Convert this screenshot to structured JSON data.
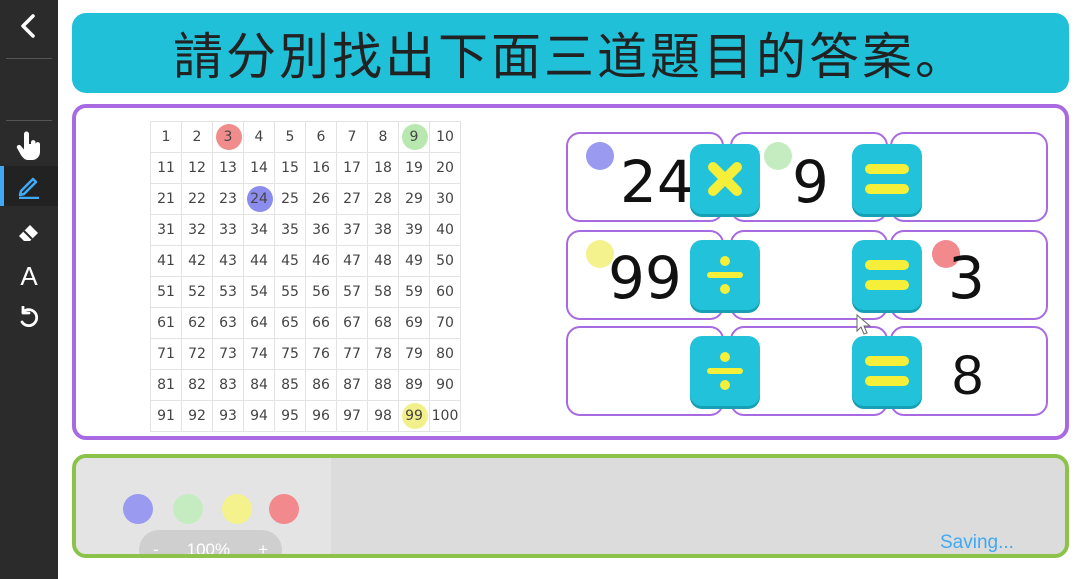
{
  "title": "請分別找出下面三道題目的答案。",
  "toolbar": {
    "items": [
      {
        "name": "back",
        "icon": "chevron-left-icon"
      },
      {
        "name": "pointer",
        "icon": "hand-pointer-icon"
      },
      {
        "name": "pen",
        "icon": "pen-icon"
      },
      {
        "name": "eraser",
        "icon": "eraser-icon"
      },
      {
        "name": "text",
        "icon": "text-icon",
        "label": "A"
      },
      {
        "name": "undo",
        "icon": "undo-icon"
      }
    ],
    "active": "pen"
  },
  "hundred_chart": {
    "rows": [
      [
        "1",
        "2",
        "3",
        "4",
        "5",
        "6",
        "7",
        "8",
        "9",
        "10"
      ],
      [
        "11",
        "12",
        "13",
        "14",
        "15",
        "16",
        "17",
        "18",
        "19",
        "20"
      ],
      [
        "21",
        "22",
        "23",
        "24",
        "25",
        "26",
        "27",
        "28",
        "29",
        "30"
      ],
      [
        "31",
        "32",
        "33",
        "34",
        "35",
        "36",
        "37",
        "38",
        "39",
        "40"
      ],
      [
        "41",
        "42",
        "43",
        "44",
        "45",
        "46",
        "47",
        "48",
        "49",
        "50"
      ],
      [
        "51",
        "52",
        "53",
        "54",
        "55",
        "56",
        "57",
        "58",
        "59",
        "60"
      ],
      [
        "61",
        "62",
        "63",
        "64",
        "65",
        "66",
        "67",
        "68",
        "69",
        "70"
      ],
      [
        "71",
        "72",
        "73",
        "74",
        "75",
        "76",
        "77",
        "78",
        "79",
        "80"
      ],
      [
        "81",
        "82",
        "83",
        "84",
        "85",
        "86",
        "87",
        "88",
        "89",
        "90"
      ],
      [
        "91",
        "92",
        "93",
        "94",
        "95",
        "96",
        "97",
        "98",
        "99",
        "100"
      ]
    ],
    "highlights": [
      {
        "number": "3",
        "color": "#f08c8c"
      },
      {
        "number": "9",
        "color": "#b8e8b0"
      },
      {
        "number": "24",
        "color": "#8c8cee"
      },
      {
        "number": "99",
        "color": "#f2f08a"
      }
    ]
  },
  "equations": [
    {
      "a": "24",
      "op": "×",
      "b": "9",
      "result": ""
    },
    {
      "a": "99",
      "op": "÷",
      "b": "",
      "result": "3"
    },
    {
      "a": "",
      "op": "÷",
      "b": "",
      "result": "8"
    }
  ],
  "colors": {
    "blue": "#9a9af0",
    "green": "#c4ecc0",
    "yellow": "#f4f28c",
    "red": "#f2898c",
    "accent": "#1fc0d8",
    "panel_border": "#a86ae0",
    "tray_border": "#8bc34a"
  },
  "tray": {
    "palette": [
      "blue",
      "green",
      "yellow",
      "red"
    ],
    "zoom": {
      "minus": "-",
      "value": "100%",
      "plus": "+"
    },
    "status": "Saving..."
  }
}
